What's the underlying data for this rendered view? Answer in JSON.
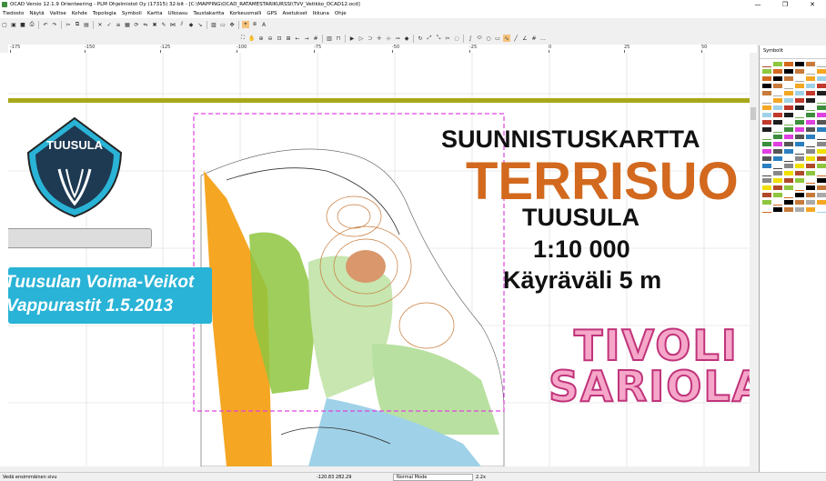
{
  "window": {
    "title": "OCAD Versio 12.1.9  Orienteering - PLM Ohjelmistot Oy (17315) 32-bit - [C:\\MAPPING\\OCAD_RATAMESTARIKURSSI\\TVV_Vetikko_OCAD12.ocd]",
    "minimize": "—",
    "restore": "❐",
    "close": "✕"
  },
  "menu": [
    "Tiedosto",
    "Näytä",
    "Valitse",
    "Kohde",
    "Topologia",
    "Symboli",
    "Kartta",
    "Ulkoasu",
    "Taustakartta",
    "Korkeusmalli",
    "GPS",
    "Asetukset",
    "Ikkuna",
    "Ohje"
  ],
  "ruler": {
    "top_ticks": [
      "-175",
      "-150",
      "-125",
      "-100",
      "-75",
      "-50",
      "-25",
      "0",
      "25",
      "50"
    ]
  },
  "map": {
    "heading": "SUUNNISTUSKARTTA",
    "name": "TERRISUO",
    "place": "TUUSULA",
    "scale": "1:10 000",
    "contour": "Käyräväli 5 m",
    "club_logo_text": "TUUSULA",
    "event_line1": "Tuusulan Voima-Veikot",
    "event_line2": "Vappurastit 1.5.2013",
    "sponsor_line1": "TIVOLI",
    "sponsor_line2": "SARIOLA",
    "colors": {
      "title_orange": "#d2691e",
      "event_bg": "#29b3d6",
      "frame_magenta": "#e040e0",
      "olive_line": "#a8a81a",
      "forest_green": "#8ec63f",
      "open_land": "#f5a623",
      "sponsor_pink": "#f5a6c9"
    }
  },
  "symbols_panel": {
    "title": "Symbolit"
  },
  "status": {
    "hint": "Vedä ensimmäinen sivu",
    "coords": "-120.83   282.29",
    "mode": "Normal Mode",
    "zoom": "2.2x"
  }
}
